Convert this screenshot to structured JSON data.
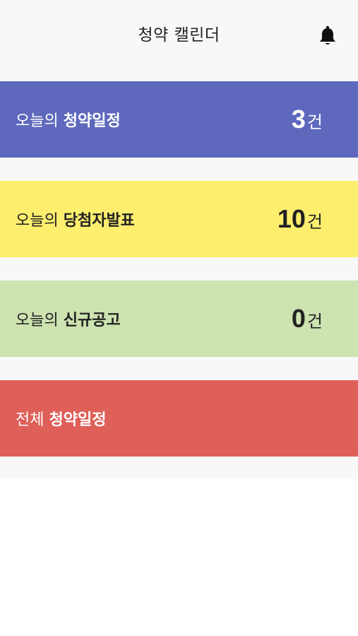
{
  "header": {
    "title": "청약 캘린더",
    "bell_icon": "bell-icon"
  },
  "cards": [
    {
      "prefix": "오늘의 ",
      "bold": "청약일정",
      "count": "3",
      "unit": "건",
      "color": "#5e68bd"
    },
    {
      "prefix": "오늘의 ",
      "bold": "당첨자발표",
      "count": "10",
      "unit": "건",
      "color": "#fdee6e"
    },
    {
      "prefix": "오늘의 ",
      "bold": "신규공고",
      "count": "0",
      "unit": "건",
      "color": "#cde3b0"
    },
    {
      "prefix": "전체 ",
      "bold": "청약일정",
      "color": "#df5f59"
    }
  ]
}
